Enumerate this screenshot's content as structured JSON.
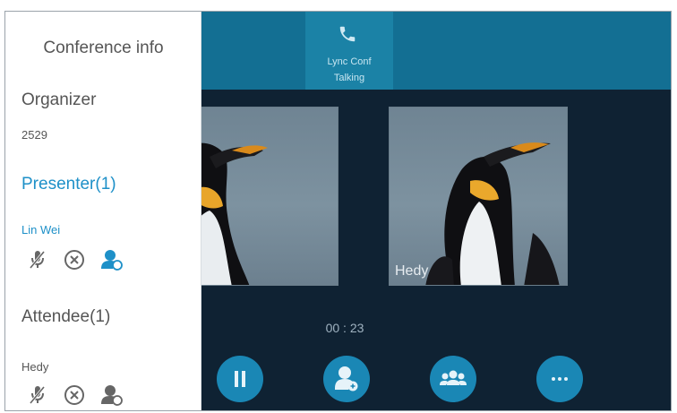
{
  "call_tab": {
    "name": "Lync Conf",
    "status": "Talking",
    "icon": "phone-icon"
  },
  "videos": [
    {
      "label": ""
    },
    {
      "label": "Hedy"
    }
  ],
  "timer": "00 : 23",
  "controls": [
    {
      "name": "hold",
      "icon": "pause-icon"
    },
    {
      "name": "add-participant",
      "icon": "add-user-icon"
    },
    {
      "name": "manage",
      "icon": "group-icon"
    },
    {
      "name": "more",
      "icon": "more-icon"
    }
  ],
  "conference_info": {
    "title": "Conference info",
    "organizer": {
      "heading": "Organizer",
      "value": "2529"
    },
    "presenter": {
      "heading": "Presenter(1)",
      "members": [
        {
          "name": "Lin Wei",
          "icons": [
            "mute-mic-icon",
            "remove-icon",
            "presenter-role-icon"
          ]
        }
      ]
    },
    "attendee": {
      "heading": "Attendee(1)",
      "members": [
        {
          "name": "Hedy",
          "icons": [
            "mute-mic-icon",
            "remove-icon",
            "attendee-role-icon"
          ]
        }
      ]
    }
  },
  "colors": {
    "accent": "#1e90c8",
    "topbar": "#136f93",
    "background": "#0f2233",
    "button": "#1a87b5"
  }
}
